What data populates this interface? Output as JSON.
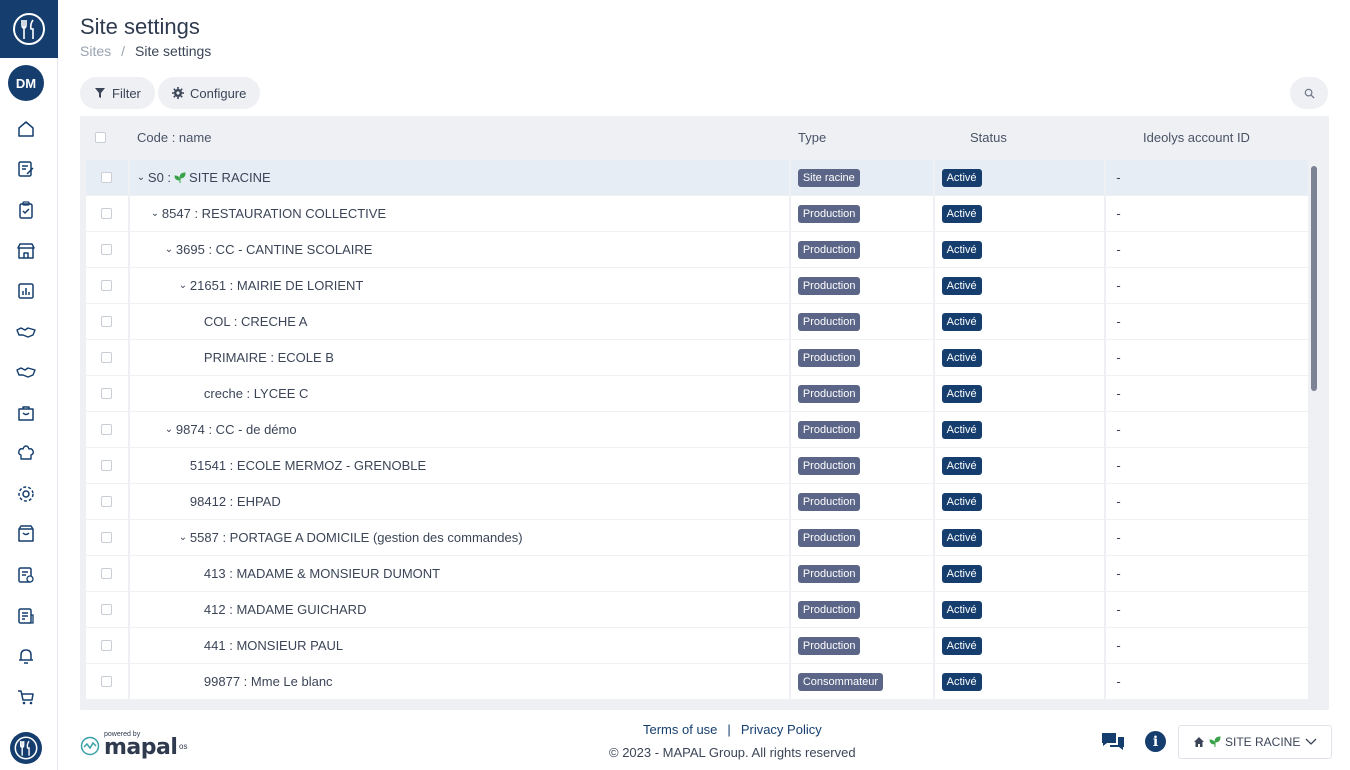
{
  "header": {
    "title": "Site settings",
    "breadcrumb": [
      "Sites",
      "Site settings"
    ],
    "breadcrumb_sep": "/"
  },
  "user": {
    "initials": "DM"
  },
  "sidebar": {
    "icons": [
      "home-icon",
      "edit-note-icon",
      "clipboard-icon",
      "store-icon",
      "dashboard-icon",
      "handshake-icon",
      "handshake-alt-icon",
      "bag-icon",
      "chef-hat-icon",
      "gear-icon",
      "archive-icon",
      "checklist-icon",
      "report-icon",
      "bell-icon",
      "cart-icon"
    ]
  },
  "toolbar": {
    "filter_label": "Filter",
    "configure_label": "Configure"
  },
  "table": {
    "columns": [
      "Code : name",
      "Type",
      "Status",
      "Ideolys account ID"
    ],
    "rows": [
      {
        "name": "S0 : ",
        "suffix": "SITE RACINE",
        "leaf": true,
        "level": 0,
        "expanded": true,
        "type": "Site racine",
        "status": "Activé",
        "account": "-",
        "selected": true
      },
      {
        "name": "8547 : RESTAURATION COLLECTIVE",
        "level": 1,
        "expanded": true,
        "type": "Production",
        "status": "Activé",
        "account": "-"
      },
      {
        "name": "3695 : CC - CANTINE SCOLAIRE",
        "level": 2,
        "expanded": true,
        "type": "Production",
        "status": "Activé",
        "account": "-"
      },
      {
        "name": "21651 : MAIRIE DE LORIENT",
        "level": 3,
        "expanded": true,
        "type": "Production",
        "status": "Activé",
        "account": "-"
      },
      {
        "name": "COL : CRECHE A",
        "level": 4,
        "type": "Production",
        "status": "Activé",
        "account": "-"
      },
      {
        "name": "PRIMAIRE : ECOLE B",
        "level": 4,
        "type": "Production",
        "status": "Activé",
        "account": "-"
      },
      {
        "name": "creche : LYCEE C",
        "level": 4,
        "type": "Production",
        "status": "Activé",
        "account": "-"
      },
      {
        "name": "9874 : CC - de démo",
        "level": 2,
        "expanded": true,
        "type": "Production",
        "status": "Activé",
        "account": "-"
      },
      {
        "name": "51541 : ECOLE MERMOZ - GRENOBLE",
        "level": 3,
        "type": "Production",
        "status": "Activé",
        "account": "-"
      },
      {
        "name": "98412 : EHPAD",
        "level": 3,
        "type": "Production",
        "status": "Activé",
        "account": "-"
      },
      {
        "name": "5587 : PORTAGE A DOMICILE (gestion des commandes)",
        "level": 3,
        "expanded": true,
        "type": "Production",
        "status": "Activé",
        "account": "-"
      },
      {
        "name": "413 : MADAME & MONSIEUR DUMONT",
        "level": 4,
        "type": "Production",
        "status": "Activé",
        "account": "-"
      },
      {
        "name": "412 : MADAME GUICHARD",
        "level": 4,
        "type": "Production",
        "status": "Activé",
        "account": "-"
      },
      {
        "name": "441 : MONSIEUR PAUL",
        "level": 4,
        "type": "Production",
        "status": "Activé",
        "account": "-"
      },
      {
        "name": "99877 : Mme Le blanc",
        "level": 4,
        "type": "Consommateur",
        "status": "Activé",
        "account": "-"
      }
    ]
  },
  "footer": {
    "powered_by": "powered by",
    "brand": "mapal",
    "brand_suffix": "os",
    "terms": "Terms of use",
    "link_sep": "|",
    "privacy": "Privacy Policy",
    "copyright": "© 2023 - MAPAL Group. All rights reserved",
    "site_selector": "SITE RACINE"
  },
  "colors": {
    "brand": "#153e6e",
    "badge_type": "#5b6587",
    "row_selected": "#e6edf5",
    "table_bg": "#eef0f4",
    "leaf_green": "#3aa34a"
  }
}
